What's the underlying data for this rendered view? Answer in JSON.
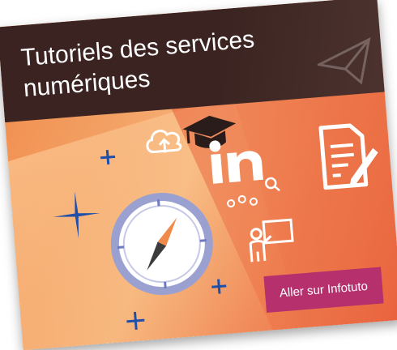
{
  "card": {
    "title_line1": "Tutoriels des services",
    "title_line2": "numériques",
    "cta_label": "Aller sur Infotuto"
  },
  "colors": {
    "header": "#3a2320",
    "button": "#b5306d",
    "accent_blue": "#1f4fa8",
    "compass_ring": "#9aa0d0"
  },
  "icons": [
    "compass-icon",
    "cloud-upload-icon",
    "graduation-cap-icon",
    "linkedin-learning-icon",
    "document-signature-icon",
    "search-icon",
    "teacher-board-icon",
    "network-icon",
    "paper-plane-icon",
    "sparkle-icon"
  ]
}
